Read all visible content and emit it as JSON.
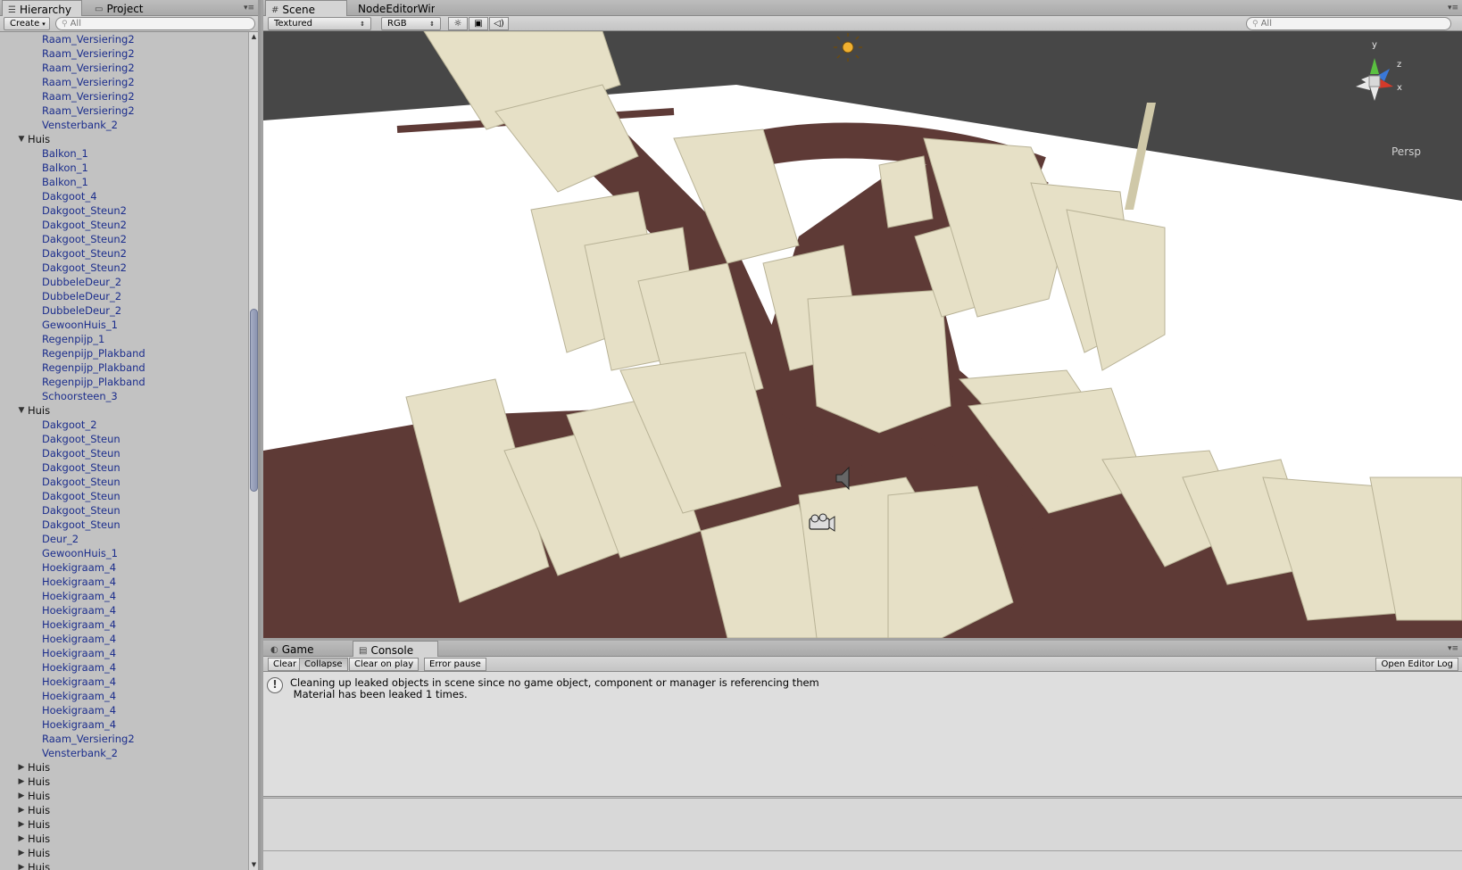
{
  "left_panel": {
    "tabs": [
      {
        "label": "Hierarchy",
        "icon": "list-icon"
      },
      {
        "label": "Project",
        "icon": "folder-icon"
      }
    ],
    "create_label": "Create",
    "search_placeholder": "All"
  },
  "hierarchy": {
    "rows_top": [
      "Raam_Versiering2",
      "Raam_Versiering2",
      "Raam_Versiering2",
      "Raam_Versiering2",
      "Raam_Versiering2",
      "Raam_Versiering2",
      "Vensterbank_2"
    ],
    "group1": {
      "label": "Huis",
      "children": [
        "Balkon_1",
        "Balkon_1",
        "Balkon_1",
        "Dakgoot_4",
        "Dakgoot_Steun2",
        "Dakgoot_Steun2",
        "Dakgoot_Steun2",
        "Dakgoot_Steun2",
        "Dakgoot_Steun2",
        "DubbeleDeur_2",
        "DubbeleDeur_2",
        "DubbeleDeur_2",
        "GewoonHuis_1",
        "Regenpijp_1",
        "Regenpijp_Plakband",
        "Regenpijp_Plakband",
        "Regenpijp_Plakband",
        "Schoorsteen_3"
      ]
    },
    "group2": {
      "label": "Huis",
      "children": [
        "Dakgoot_2",
        "Dakgoot_Steun",
        "Dakgoot_Steun",
        "Dakgoot_Steun",
        "Dakgoot_Steun",
        "Dakgoot_Steun",
        "Dakgoot_Steun",
        "Dakgoot_Steun",
        "Deur_2",
        "GewoonHuis_1",
        "Hoekigraam_4",
        "Hoekigraam_4",
        "Hoekigraam_4",
        "Hoekigraam_4",
        "Hoekigraam_4",
        "Hoekigraam_4",
        "Hoekigraam_4",
        "Hoekigraam_4",
        "Hoekigraam_4",
        "Hoekigraam_4",
        "Hoekigraam_4",
        "Hoekigraam_4",
        "Raam_Versiering2",
        "Vensterbank_2"
      ]
    },
    "collapsed": [
      "Huis",
      "Huis",
      "Huis",
      "Huis",
      "Huis",
      "Huis",
      "Huis",
      "Huis"
    ]
  },
  "scene_panel": {
    "tabs": [
      {
        "label": "Scene",
        "icon": "grid-icon"
      },
      {
        "label": "NodeEditorWin",
        "icon": ""
      }
    ],
    "render_mode": "Textured",
    "color_mode": "RGB",
    "search_placeholder": "All",
    "projection_label": "Persp",
    "gizmo": {
      "y": "y",
      "z": "z",
      "x": "x"
    }
  },
  "console_panel": {
    "tabs": [
      {
        "label": "Game",
        "icon": "pacman-icon"
      },
      {
        "label": "Console",
        "icon": "console-icon"
      }
    ],
    "buttons": {
      "clear": "Clear",
      "collapse": "Collapse",
      "clear_on_play": "Clear on play",
      "error_pause": "Error pause",
      "open_editor_log": "Open Editor Log"
    },
    "log": {
      "line1": "Cleaning up leaked objects in scene since no game object, component or manager is referencing them",
      "line2": " Material has been leaked 1 times."
    }
  },
  "colors": {
    "panel_bg": "#c2c2c2",
    "hierarchy_text": "#1b2d8c",
    "viewport_sky": "#474747",
    "ground_white": "#ffffff",
    "road": "#5e3a36",
    "building": "#e6e0c6"
  }
}
